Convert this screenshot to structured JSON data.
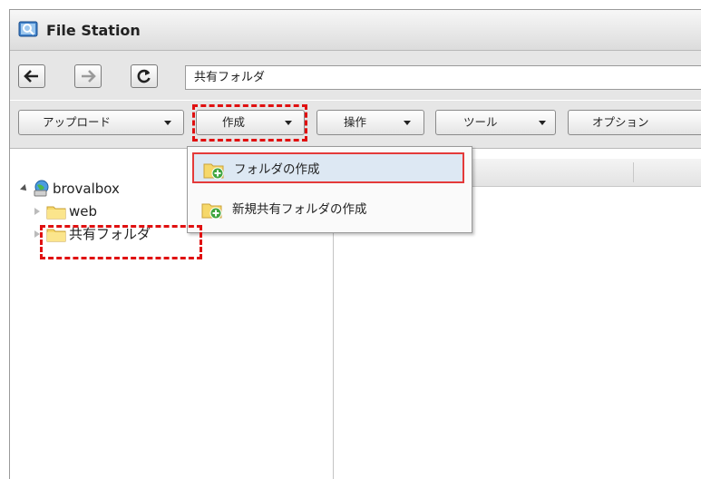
{
  "app": {
    "title": "File Station"
  },
  "nav": {
    "path": "共有フォルダ"
  },
  "toolbar": {
    "upload_label": "アップロード",
    "create_label": "作成",
    "operate_label": "操作",
    "tools_label": "ツール",
    "options_label": "オプション"
  },
  "tree": {
    "root": "brovalbox",
    "children": [
      "web",
      "共有フォルダ"
    ]
  },
  "menu": {
    "items": [
      "フォルダの作成",
      "新規共有フォルダの作成"
    ]
  },
  "colors": {
    "highlight_red": "#e01010",
    "menu_hover": "#dde8f3",
    "folder_yellow": "#f6d86a"
  }
}
